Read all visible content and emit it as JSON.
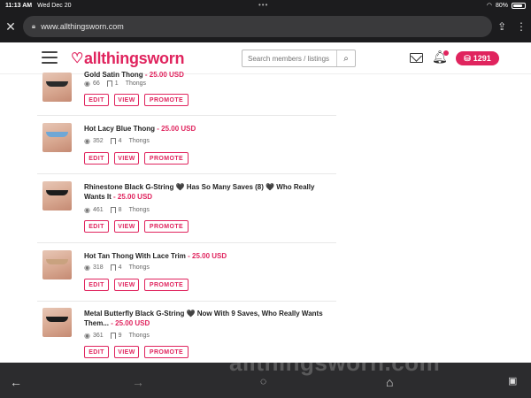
{
  "status": {
    "time": "11:13 AM",
    "date": "Wed Dec 20",
    "battery": "80%",
    "battery_level": 0.8
  },
  "browser": {
    "url": "www.allthingsworn.com",
    "dots": "•••"
  },
  "site": {
    "logo": "allthingsworn",
    "search_placeholder": "Search members / listings",
    "tokens": "1291",
    "accent": "#e0245e"
  },
  "buttons": {
    "edit": "EDIT",
    "view": "VIEW",
    "promote": "PROMOTE"
  },
  "listings": [
    {
      "title": "Gold Satin Thong",
      "price": "- 25.00 USD",
      "views": "66",
      "saves": "1",
      "category": "Thongs",
      "garment": "#2a2a2a"
    },
    {
      "title": "Hot Lacy Blue Thong",
      "price": "- 25.00 USD",
      "views": "352",
      "saves": "4",
      "category": "Thongs",
      "garment": "#6fa7d6"
    },
    {
      "title": "Rhinestone Black G-String 🖤 Has So Many Saves (8) 🖤 Who Really Wants It",
      "price": "- 25.00 USD",
      "views": "461",
      "saves": "8",
      "category": "Thongs",
      "garment": "#1c1c1c"
    },
    {
      "title": "Hot Tan Thong With Lace Trim",
      "price": "- 25.00 USD",
      "views": "318",
      "saves": "4",
      "category": "Thongs",
      "garment": "#c9a27f"
    },
    {
      "title": "Metal Butterfly Black G-String 🖤 Now With 9 Saves, Who Really Wants Them...",
      "price": "- 25.00 USD",
      "views": "361",
      "saves": "9",
      "category": "Thongs",
      "garment": "#1c1c1c"
    }
  ],
  "watermark": "allthingsworn.com"
}
